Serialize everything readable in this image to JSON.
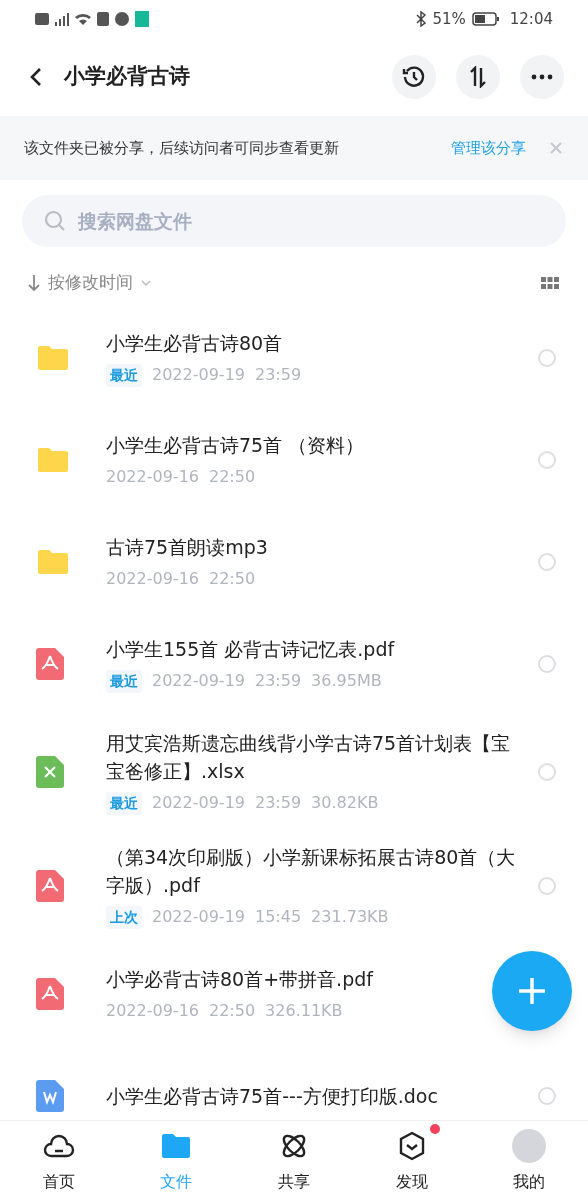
{
  "status_bar": {
    "battery": "51%",
    "time": "12:04"
  },
  "header": {
    "title": "小学必背古诗"
  },
  "banner": {
    "text": "该文件夹已被分享，后续访问者可同步查看更新",
    "link": "管理该分享"
  },
  "search": {
    "placeholder": "搜索网盘文件"
  },
  "sort": {
    "label": "按修改时间"
  },
  "files": [
    {
      "kind": "folder",
      "name": "小学生必背古诗80首",
      "tag": "最近",
      "date": "2022-09-19",
      "time": "23:59"
    },
    {
      "kind": "folder",
      "name": "小学生必背古诗75首 （资料）",
      "date": "2022-09-16",
      "time": "22:50"
    },
    {
      "kind": "folder",
      "name": "古诗75首朗读mp3",
      "date": "2022-09-16",
      "time": "22:50"
    },
    {
      "kind": "pdf",
      "name": "小学生155首 必背古诗记忆表.pdf",
      "tag": "最近",
      "date": "2022-09-19",
      "time": "23:59",
      "size": "36.95MB"
    },
    {
      "kind": "xlsx",
      "name": "用艾宾浩斯遗忘曲线背小学古诗75首计划表【宝宝爸修正】.xlsx",
      "tag": "最近",
      "date": "2022-09-19",
      "time": "23:59",
      "size": "30.82KB"
    },
    {
      "kind": "pdf",
      "name": "（第34次印刷版）小学新课标拓展古诗80首（大字版）.pdf",
      "tag": "上次",
      "date": "2022-09-19",
      "time": "15:45",
      "size": "231.73KB"
    },
    {
      "kind": "pdf",
      "name": "小学必背古诗80首+带拼音.pdf",
      "date": "2022-09-16",
      "time": "22:50",
      "size": "326.11KB",
      "circle_covered": true
    },
    {
      "kind": "doc",
      "name": "小学生必背古诗75首---方便打印版.doc"
    }
  ],
  "nav": [
    {
      "kind": "home",
      "label": "首页",
      "selected": false,
      "dot": false
    },
    {
      "kind": "files",
      "label": "文件",
      "selected": true,
      "dot": false
    },
    {
      "kind": "share",
      "label": "共享",
      "selected": false,
      "dot": false
    },
    {
      "kind": "discover",
      "label": "发现",
      "selected": false,
      "dot": true
    },
    {
      "kind": "me",
      "label": "我的",
      "selected": false,
      "dot": false
    }
  ]
}
